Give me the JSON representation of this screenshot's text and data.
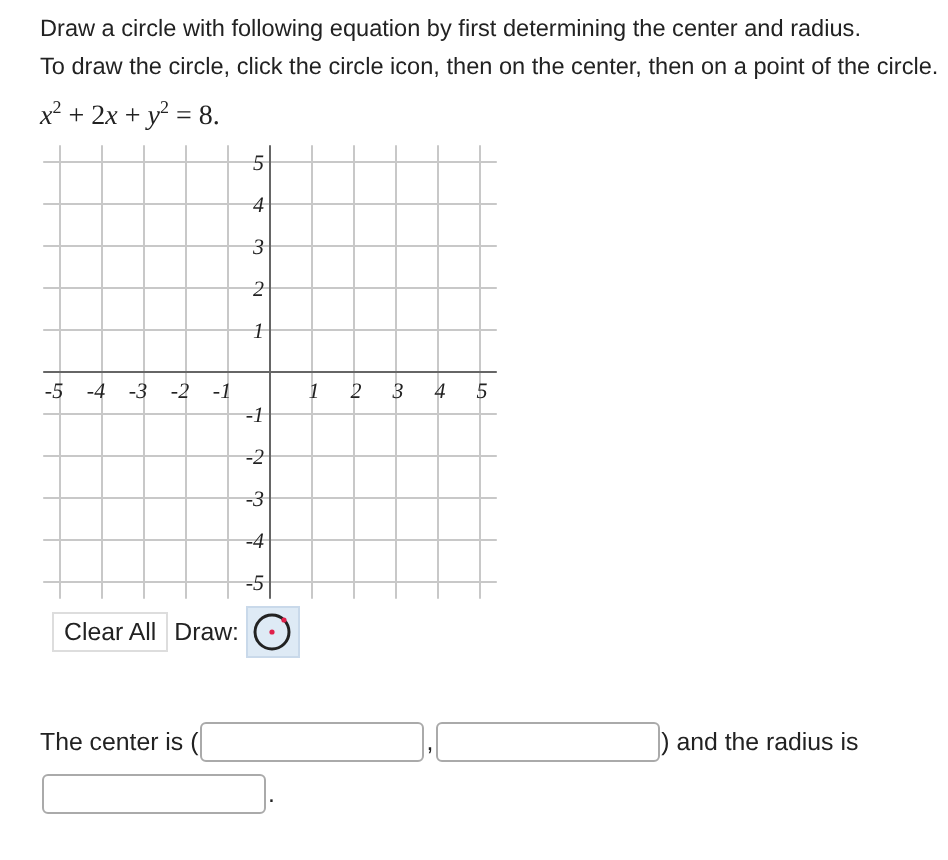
{
  "instructions": [
    "Draw a circle with following equation by first determining the center and radius.",
    "To draw the circle, click the circle icon, then on the center, then on a point of the circle."
  ],
  "equation": [
    {
      "kind": "var",
      "text": "x"
    },
    {
      "kind": "sup",
      "text": "2"
    },
    {
      "kind": "num",
      "text": " + 2"
    },
    {
      "kind": "var",
      "text": "x"
    },
    {
      "kind": "num",
      "text": " + "
    },
    {
      "kind": "var",
      "text": "y"
    },
    {
      "kind": "sup",
      "text": "2"
    },
    {
      "kind": "num",
      "text": " = 8."
    }
  ],
  "graph": {
    "x_labels": [
      "-5",
      "-4",
      "-3",
      "-2",
      "-1",
      "1",
      "2",
      "3",
      "4",
      "5"
    ],
    "y_labels": [
      "5",
      "4",
      "3",
      "2",
      "1",
      "-1",
      "-2",
      "-3",
      "-4",
      "-5"
    ]
  },
  "toolbar": {
    "clear_button": "Clear All",
    "draw_label": "Draw:",
    "tools": [
      {
        "kind": "circle",
        "selected": true
      }
    ]
  },
  "answer": {
    "parts": [
      {
        "kind": "text",
        "text": "The center is ("
      },
      {
        "kind": "field"
      },
      {
        "kind": "text",
        "text": ","
      },
      {
        "kind": "field"
      },
      {
        "kind": "text",
        "text": ") and the radius is"
      },
      {
        "kind": "break"
      },
      {
        "kind": "field"
      },
      {
        "kind": "text",
        "text": "."
      }
    ]
  }
}
